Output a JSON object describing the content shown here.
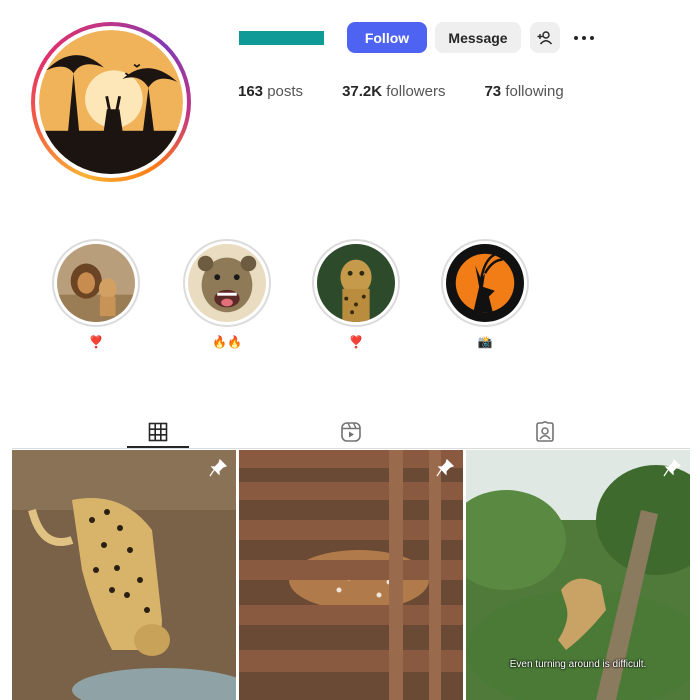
{
  "profile": {
    "follow_label": "Follow",
    "message_label": "Message",
    "stats": {
      "posts_count": "163",
      "posts_label": "posts",
      "followers_count": "37.2K",
      "followers_label": "followers",
      "following_count": "73",
      "following_label": "following"
    },
    "colors": {
      "username_bar": "#0f9a97",
      "follow_button": "#4f63f2"
    }
  },
  "highlights": [
    {
      "label": "❣️",
      "icon": "lions-photo"
    },
    {
      "label": "🔥🔥",
      "icon": "hyena-photo"
    },
    {
      "label": "❣️",
      "icon": "leopard-photo"
    },
    {
      "label": "📸",
      "icon": "antelope-logo"
    }
  ],
  "tabs": [
    {
      "name": "posts",
      "icon": "grid-icon",
      "active": true
    },
    {
      "name": "reels",
      "icon": "reels-icon",
      "active": false
    },
    {
      "name": "tagged",
      "icon": "tagged-icon",
      "active": false
    }
  ],
  "posts": [
    {
      "subject": "cheetah drinking",
      "pinned": true,
      "caption": ""
    },
    {
      "subject": "deer behind wooden fence",
      "pinned": true,
      "caption": ""
    },
    {
      "subject": "lioness climbing tree",
      "pinned": true,
      "caption": "Even turning around is difficult."
    }
  ]
}
